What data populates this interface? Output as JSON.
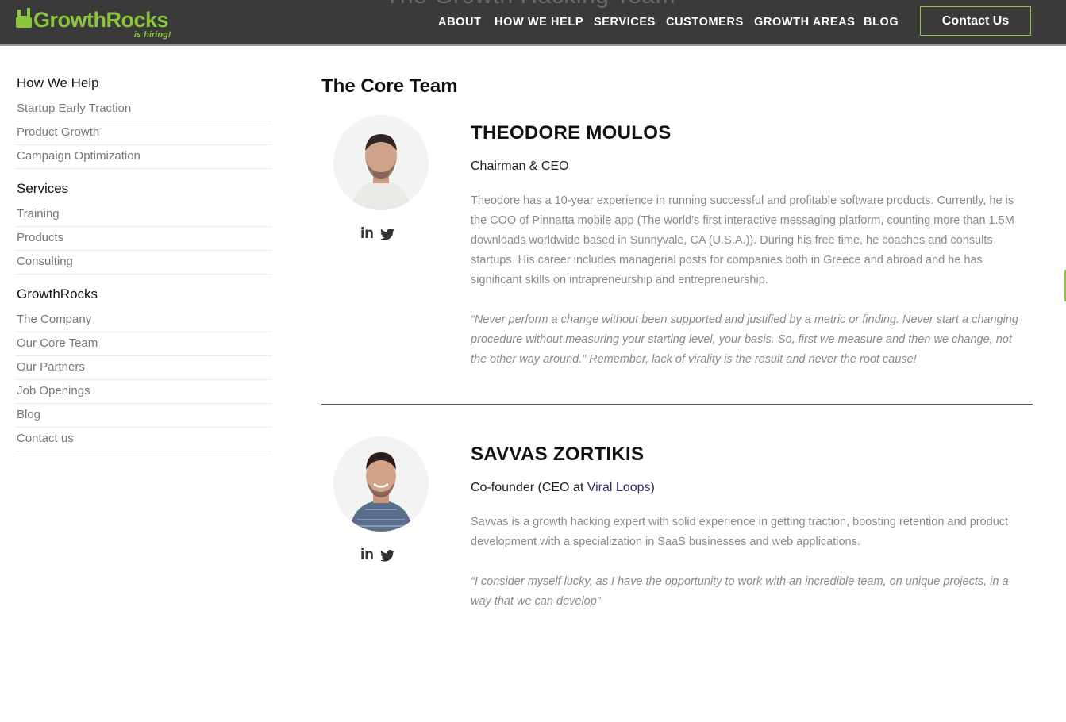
{
  "header": {
    "ghost_title": "The Growth Hacking Team",
    "logo": {
      "text": "GrowthRocks",
      "sub": "is hiring!"
    },
    "nav": [
      "ABOUT",
      "HOW WE HELP",
      "SERVICES",
      "CUSTOMERS",
      "GROWTH AREAS",
      "BLOG"
    ],
    "contact_label": "Contact Us",
    "accent_color": "#8cc63f"
  },
  "sidebar": {
    "groups": [
      {
        "title": "How We Help",
        "items": [
          "Startup Early Traction",
          "Product Growth",
          "Campaign Optimization"
        ]
      },
      {
        "title": "Services",
        "items": [
          "Training",
          "Products",
          "Consulting"
        ]
      },
      {
        "title": "GrowthRocks",
        "items": [
          "The Company",
          "Our Core Team",
          "Our Partners",
          "Job Openings",
          "Blog",
          "Contact us"
        ]
      }
    ]
  },
  "main": {
    "title": "The Core Team",
    "members": [
      {
        "name": "THEODORE MOULOS",
        "role": "Chairman & CEO",
        "bio": "Theodore has a 10-year experience in running successful and profitable software products. Currently, he is the COO of Pinnatta mobile app (The world’s first interactive messaging platform, counting more than 1.5M downloads worldwide based in Sunnyvale, CA (U.S.A.)). During his free time, he coaches and consults startups. His career includes managerial posts for companies both in Greece and abroad and he has significant skills on intrapreneurship and entrepreneurship.",
        "quote": "“Never perform a change without been supported and justified by a metric or finding. Never start a changing procedure without measuring your starting level, your basis. So, first we measure and then we change, not the other way around.” Remember, lack of virality is the result and never the root cause!"
      },
      {
        "name": "SAVVAS ZORTIKIS",
        "role_prefix": "Co-founder (CEO at ",
        "role_link": "Viral Loops",
        "role_suffix": ")",
        "bio": "Savvas is a growth hacking expert with solid experience in getting traction, boosting retention and product development with a specialization in SaaS businesses and web applications.",
        "quote": "“I consider myself lucky, as I have the opportunity to work with an incredible team, on unique projects, in a way that we can develop”"
      }
    ],
    "social_icons": [
      "linkedin-icon",
      "twitter-icon"
    ]
  }
}
